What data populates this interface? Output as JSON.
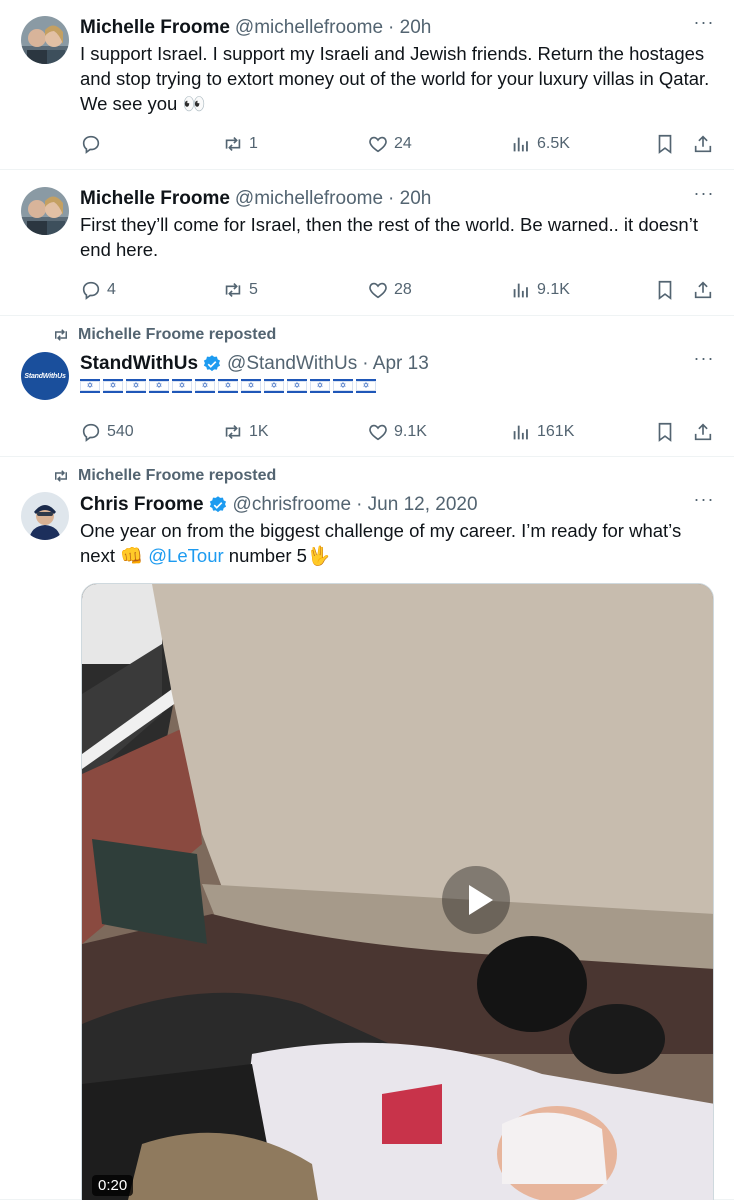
{
  "tweets": [
    {
      "name": "Michelle Froome",
      "handle": "@michellefroome",
      "time": "· 20h",
      "text": "I support Israel. I support my Israeli and Jewish friends. Return the hostages and stop trying to extort money out of the world for your luxury villas in Qatar. We see you 👀",
      "replies": "",
      "reposts": "1",
      "likes": "24",
      "views": "6.5K"
    },
    {
      "name": "Michelle Froome",
      "handle": "@michellefroome",
      "time": "· 20h",
      "text": "First they’ll come for Israel, then the rest of the world. Be warned.. it doesn’t end here.",
      "replies": "4",
      "reposts": "5",
      "likes": "28",
      "views": "9.1K"
    },
    {
      "reposted_by": "Michelle Froome reposted",
      "name": "StandWithUs",
      "handle": "@StandWithUs",
      "time": "· Apr 13",
      "avatar_text": "StandWithUs",
      "flag_count": 13,
      "replies": "540",
      "reposts": "1K",
      "likes": "9.1K",
      "views": "161K"
    },
    {
      "reposted_by": "Michelle Froome reposted",
      "name": "Chris Froome",
      "handle": "@chrisfroome",
      "time": "· Jun 12, 2020",
      "text_before": "One year on from the biggest challenge of my career. I’m ready for what’s next 👊 ",
      "mention": "@LeTour",
      "text_after": " number 5🖖",
      "video_duration": "0:20"
    }
  ],
  "colors": {
    "accent": "#1d9bf0",
    "muted": "#536471",
    "divider": "#eff3f4",
    "verified": "#1d9bf0",
    "swu_blue": "#1a4f9c"
  },
  "icons": [
    "reply-icon",
    "repost-icon",
    "like-icon",
    "views-icon",
    "bookmark-icon",
    "share-icon",
    "more-icon",
    "verified-icon",
    "play-icon"
  ]
}
